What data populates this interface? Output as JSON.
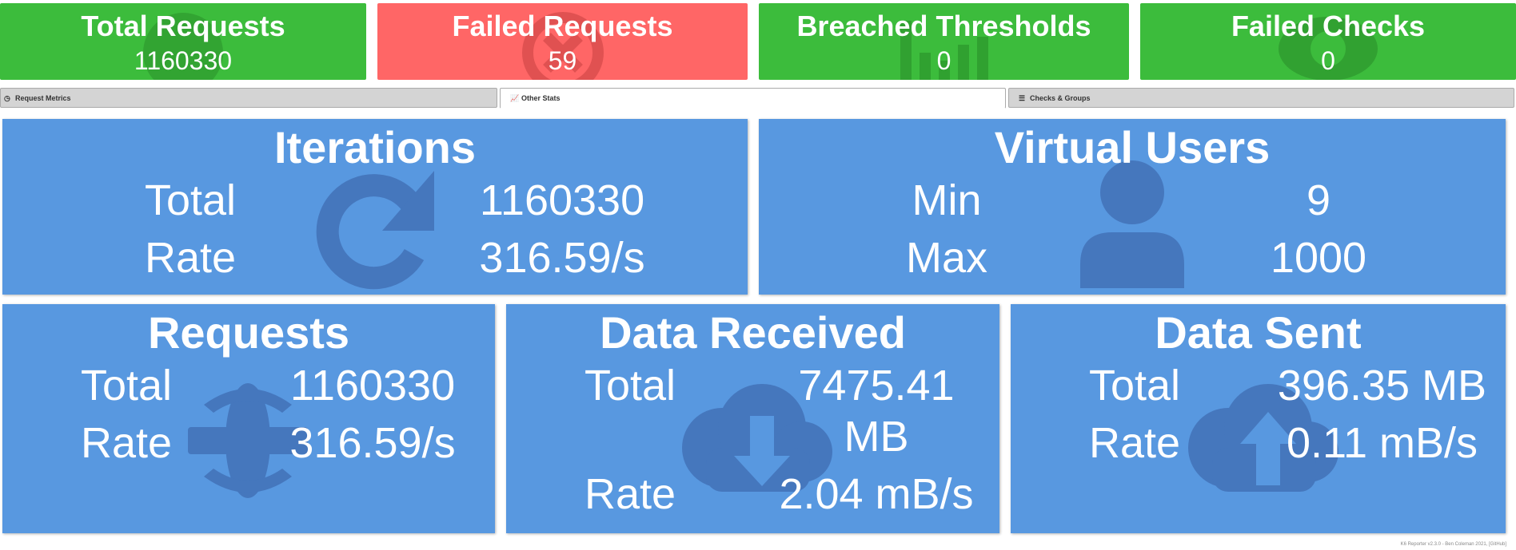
{
  "summary": {
    "total_requests": {
      "title": "Total Requests",
      "value": "1160330"
    },
    "failed_requests": {
      "title": "Failed Requests",
      "value": "59"
    },
    "breached_thresholds": {
      "title": "Breached Thresholds",
      "value": "0"
    },
    "failed_checks": {
      "title": "Failed Checks",
      "value": "0"
    }
  },
  "tabs": [
    {
      "label": "Request Metrics",
      "icon": "clock-icon"
    },
    {
      "label": "Other Stats",
      "icon": "chart-icon"
    },
    {
      "label": "Checks & Groups",
      "icon": "list-icon"
    }
  ],
  "iterations": {
    "title": "Iterations",
    "total_label": "Total",
    "total_value": "1160330",
    "rate_label": "Rate",
    "rate_value": "316.59/s"
  },
  "virtual_users": {
    "title": "Virtual Users",
    "min_label": "Min",
    "min_value": "9",
    "max_label": "Max",
    "max_value": "1000"
  },
  "requests": {
    "title": "Requests",
    "total_label": "Total",
    "total_value": "1160330",
    "rate_label": "Rate",
    "rate_value": "316.59/s"
  },
  "data_received": {
    "title": "Data Received",
    "total_label": "Total",
    "total_value_line1": "7475.41",
    "total_value_line2": "MB",
    "rate_label": "Rate",
    "rate_value": "2.04 mB/s"
  },
  "data_sent": {
    "title": "Data Sent",
    "total_label": "Total",
    "total_value": "396.35 MB",
    "rate_label": "Rate",
    "rate_value": "0.11 mB/s"
  },
  "footer": "K6 Reporter v2.3.0 - Ben Coleman 2021, [GitHub]",
  "colors": {
    "green": "#3cbc3c",
    "red": "#ff6666",
    "card_blue": "#5898e0",
    "icon_shade": "#4577bd"
  }
}
